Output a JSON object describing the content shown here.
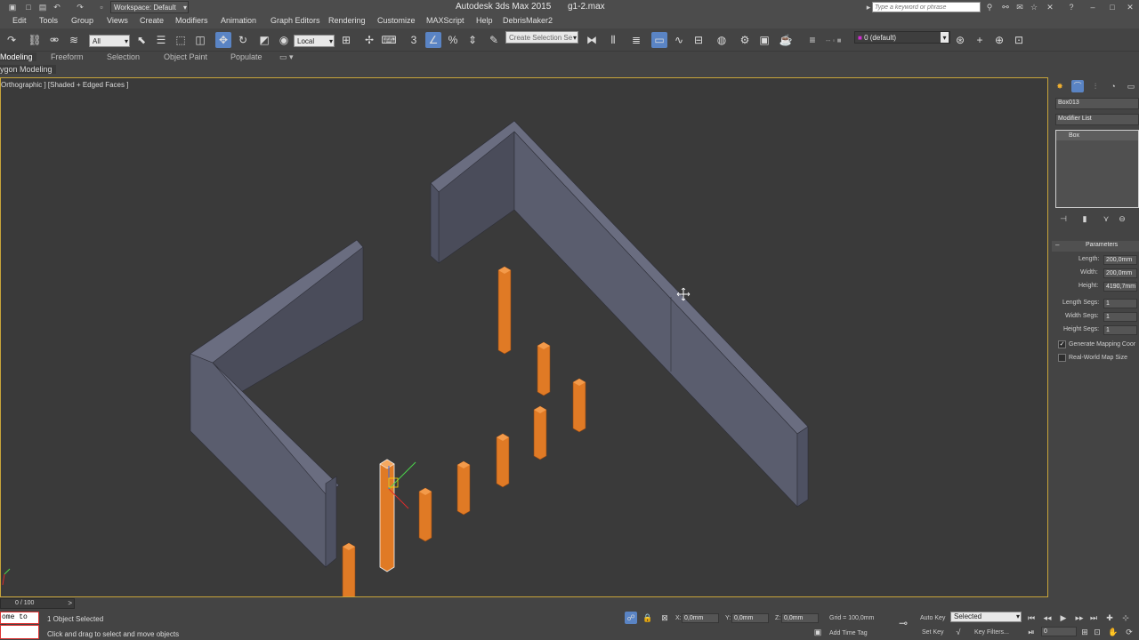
{
  "titlebar": {
    "workspace_label": "Workspace: Default",
    "app_title": "Autodesk 3ds Max  2015",
    "file_name": "g1-2.max",
    "search_placeholder": "Type a keyword or phrase"
  },
  "menu": {
    "items": [
      "Edit",
      "Tools",
      "Group",
      "Views",
      "Create",
      "Modifiers",
      "Animation",
      "Graph Editors",
      "Rendering",
      "Customize",
      "MAXScript",
      "Help",
      "DebrisMaker2"
    ]
  },
  "toolbar": {
    "filter_value": "All",
    "coord_value": "Local",
    "selection_set_placeholder": "Create Selection Se",
    "layer_value": "0 (default)"
  },
  "ribbon": {
    "tabs": [
      "Modeling",
      "Freeform",
      "Selection",
      "Object Paint",
      "Populate"
    ],
    "sub_label": "ygon Modeling"
  },
  "viewport": {
    "label": "Orthographic ] [Shaded + Edged Faces ]"
  },
  "command_panel": {
    "object_name": "Box013",
    "modifier_list_label": "Modifier List",
    "stack_item": "Box",
    "rollout_title": "Parameters",
    "params": [
      {
        "label": "Length:",
        "value": "200,0mm"
      },
      {
        "label": "Width:",
        "value": "200,0mm"
      },
      {
        "label": "Height:",
        "value": "4190,7mm"
      }
    ],
    "segs": [
      {
        "label": "Length Segs:",
        "value": "1"
      },
      {
        "label": "Width Segs:",
        "value": "1"
      },
      {
        "label": "Height Segs:",
        "value": "1"
      }
    ],
    "generate_mapping_label": "Generate Mapping Coor",
    "generate_mapping_checked": true,
    "real_world_label": "Real-World Map Size",
    "real_world_checked": false
  },
  "bottom": {
    "timeline_label": "0 / 100",
    "maxscript_text": "ome to M:",
    "status_selected": "1 Object Selected",
    "prompt": "Click and drag to select and move objects",
    "x_label": "X:",
    "x_value": "0,0mm",
    "y_label": "Y:",
    "y_value": "0,0mm",
    "z_label": "Z:",
    "z_value": "0,0mm",
    "grid_label": "Grid = 100,0mm",
    "add_time_tag": "Add Time Tag",
    "auto_key": "Auto Key",
    "set_key": "Set Key",
    "selected_value": "Selected",
    "key_filters": "Key Filters...",
    "frame_value": "0"
  },
  "colors": {
    "wall": "#5a5d6e",
    "wall_top": "#4a4c5a",
    "pillar": "#e07a25",
    "viewport_bg": "#3a3a3a",
    "accent": "#5a84c4"
  }
}
